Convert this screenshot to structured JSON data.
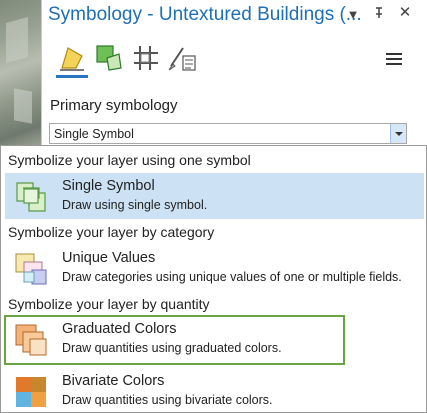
{
  "pane": {
    "title": "Symbology - Untextured Buildings (...",
    "buttons": {
      "dropdown": "▼",
      "pin": "⊣",
      "close": "✕"
    },
    "tools": [
      {
        "name": "primary-symbology",
        "icon": "paintbrush-polygon-icon",
        "active": true
      },
      {
        "name": "vary-symbology",
        "icon": "vary-symbology-icon"
      },
      {
        "name": "symbol-layer-drawing",
        "icon": "hash-grid-icon"
      },
      {
        "name": "layer-properties",
        "icon": "brush-list-icon"
      }
    ],
    "menu_icon": "hamburger-icon",
    "primary_label": "Primary symbology",
    "select": {
      "value": "Single Symbol"
    }
  },
  "dropdown": {
    "groups": [
      {
        "header": "Symbolize your layer using one symbol"
      },
      {
        "header": "Symbolize your layer by category"
      },
      {
        "header": "Symbolize your layer by quantity"
      }
    ],
    "options": [
      {
        "title": "Single Symbol",
        "description": "Draw using single symbol.",
        "selected": true
      },
      {
        "title": "Unique Values",
        "description": "Draw categories using unique values of one or multiple fields."
      },
      {
        "title": "Graduated Colors",
        "description": "Draw quantities using graduated colors.",
        "highlighted": true
      },
      {
        "title": "Bivariate Colors",
        "description": "Draw quantities using bivariate colors."
      }
    ]
  },
  "colors": {
    "title_blue": "#1f6fb5",
    "selected_row": "#cce1f3",
    "highlight_border": "#6aa440",
    "active_tab": "#2b74c1"
  }
}
